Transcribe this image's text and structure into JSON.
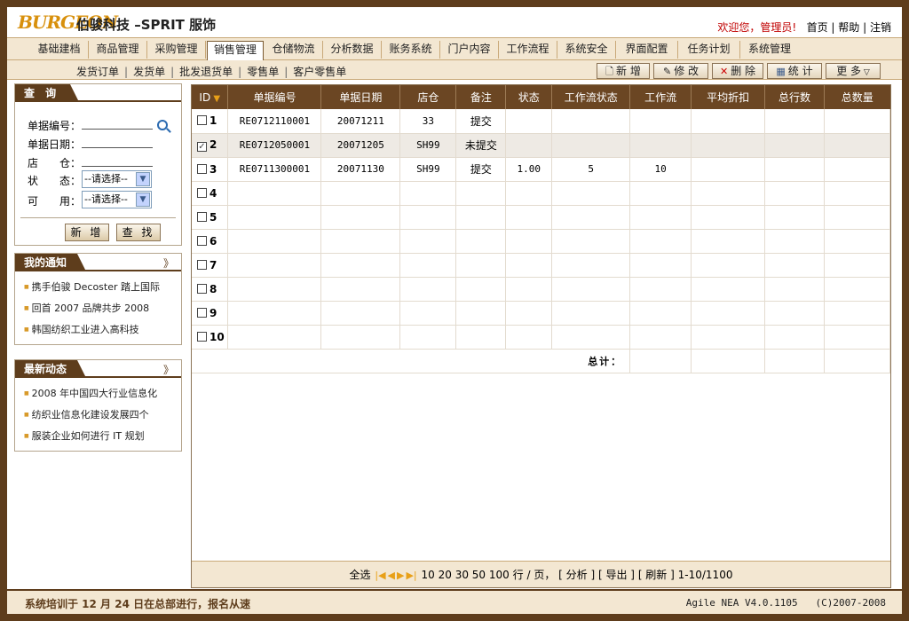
{
  "header": {
    "logo": "BURGEON",
    "company": "伯骏科技 –SPRIT 服饰",
    "welcome": "欢迎您，管理员!",
    "links": [
      "首页",
      "帮助",
      "注销"
    ]
  },
  "menu": {
    "items": [
      "基础建档",
      "商品管理",
      "采购管理",
      "销售管理",
      "仓储物流",
      "分析数据",
      "账务系统",
      "门户内容",
      "工作流程",
      "系统安全",
      "界面配置",
      "任务计划",
      "系统管理"
    ],
    "active": "销售管理"
  },
  "submenu": {
    "items": [
      "发货订单",
      "发货单",
      "批发退货单",
      "零售单",
      "客户零售单"
    ]
  },
  "toolbar": {
    "new": "新 增",
    "edit": "修 改",
    "delete": "删 除",
    "stats": "统 计",
    "more": "更 多"
  },
  "query": {
    "title": "查 询",
    "fields": {
      "doc_no": "单据编号：",
      "doc_date": "单据日期：",
      "store": "店　　仓：",
      "status": "状　　态：",
      "available": "可　　用："
    },
    "select_placeholder": "--请选择--",
    "btn_new": "新 增",
    "btn_find": "查 找"
  },
  "notices": {
    "title": "我的通知",
    "more": "》",
    "items": [
      "携手伯骏 Decoster 踏上国际",
      "回首 2007 品牌共步 2008",
      "韩国纺织工业进入高科技"
    ]
  },
  "news": {
    "title": "最新动态",
    "more": "》",
    "items": [
      "2008 年中国四大行业信息化",
      "纺织业信息化建设发展四个",
      "服装企业如何进行 IT 规划"
    ]
  },
  "grid": {
    "columns": [
      "ID",
      "单据编号",
      "单据日期",
      "店仓",
      "备注",
      "状态",
      "工作流状态",
      "工作流",
      "平均折扣",
      "总行数",
      "总数量"
    ],
    "rows": [
      {
        "id": "1",
        "checked": false,
        "doc_no": "RE0712110001",
        "date": "20071211",
        "store": "33",
        "note": "提交",
        "status": "",
        "wf_status": "",
        "wf": "",
        "discount": "",
        "lines": "",
        "qty": ""
      },
      {
        "id": "2",
        "checked": true,
        "doc_no": "RE0712050001",
        "date": "20071205",
        "store": "SH99",
        "note": "未提交",
        "status": "",
        "wf_status": "",
        "wf": "",
        "discount": "",
        "lines": "",
        "qty": ""
      },
      {
        "id": "3",
        "checked": false,
        "doc_no": "RE0711300001",
        "date": "20071130",
        "store": "SH99",
        "note": "提交",
        "status": "1.00",
        "wf_status": "5",
        "wf": "10",
        "discount": "",
        "lines": "",
        "qty": ""
      },
      {
        "id": "4",
        "checked": false,
        "doc_no": "",
        "date": "",
        "store": "",
        "note": "",
        "status": "",
        "wf_status": "",
        "wf": "",
        "discount": "",
        "lines": "",
        "qty": ""
      },
      {
        "id": "5",
        "checked": false,
        "doc_no": "",
        "date": "",
        "store": "",
        "note": "",
        "status": "",
        "wf_status": "",
        "wf": "",
        "discount": "",
        "lines": "",
        "qty": ""
      },
      {
        "id": "6",
        "checked": false,
        "doc_no": "",
        "date": "",
        "store": "",
        "note": "",
        "status": "",
        "wf_status": "",
        "wf": "",
        "discount": "",
        "lines": "",
        "qty": ""
      },
      {
        "id": "7",
        "checked": false,
        "doc_no": "",
        "date": "",
        "store": "",
        "note": "",
        "status": "",
        "wf_status": "",
        "wf": "",
        "discount": "",
        "lines": "",
        "qty": ""
      },
      {
        "id": "8",
        "checked": false,
        "doc_no": "",
        "date": "",
        "store": "",
        "note": "",
        "status": "",
        "wf_status": "",
        "wf": "",
        "discount": "",
        "lines": "",
        "qty": ""
      },
      {
        "id": "9",
        "checked": false,
        "doc_no": "",
        "date": "",
        "store": "",
        "note": "",
        "status": "",
        "wf_status": "",
        "wf": "",
        "discount": "",
        "lines": "",
        "qty": ""
      },
      {
        "id": "10",
        "checked": false,
        "doc_no": "",
        "date": "",
        "store": "",
        "note": "",
        "status": "",
        "wf_status": "",
        "wf": "",
        "discount": "",
        "lines": "",
        "qty": ""
      }
    ],
    "total_label": "总计："
  },
  "pager": {
    "select_all": "全选",
    "page_sizes": [
      "10",
      "20",
      "30",
      "50",
      "100"
    ],
    "per_page": "行 / 页，",
    "analyze": "[ 分析 ]",
    "export": "[ 导出 ]",
    "refresh": "[ 刷新 ]",
    "range": "1-10/1100"
  },
  "footer": {
    "notice": "系统培训于 12 月 24 日在总部进行，报名从速",
    "version": "Agile NEA V4.0.1105",
    "copyright": "(C)2007-2008"
  }
}
